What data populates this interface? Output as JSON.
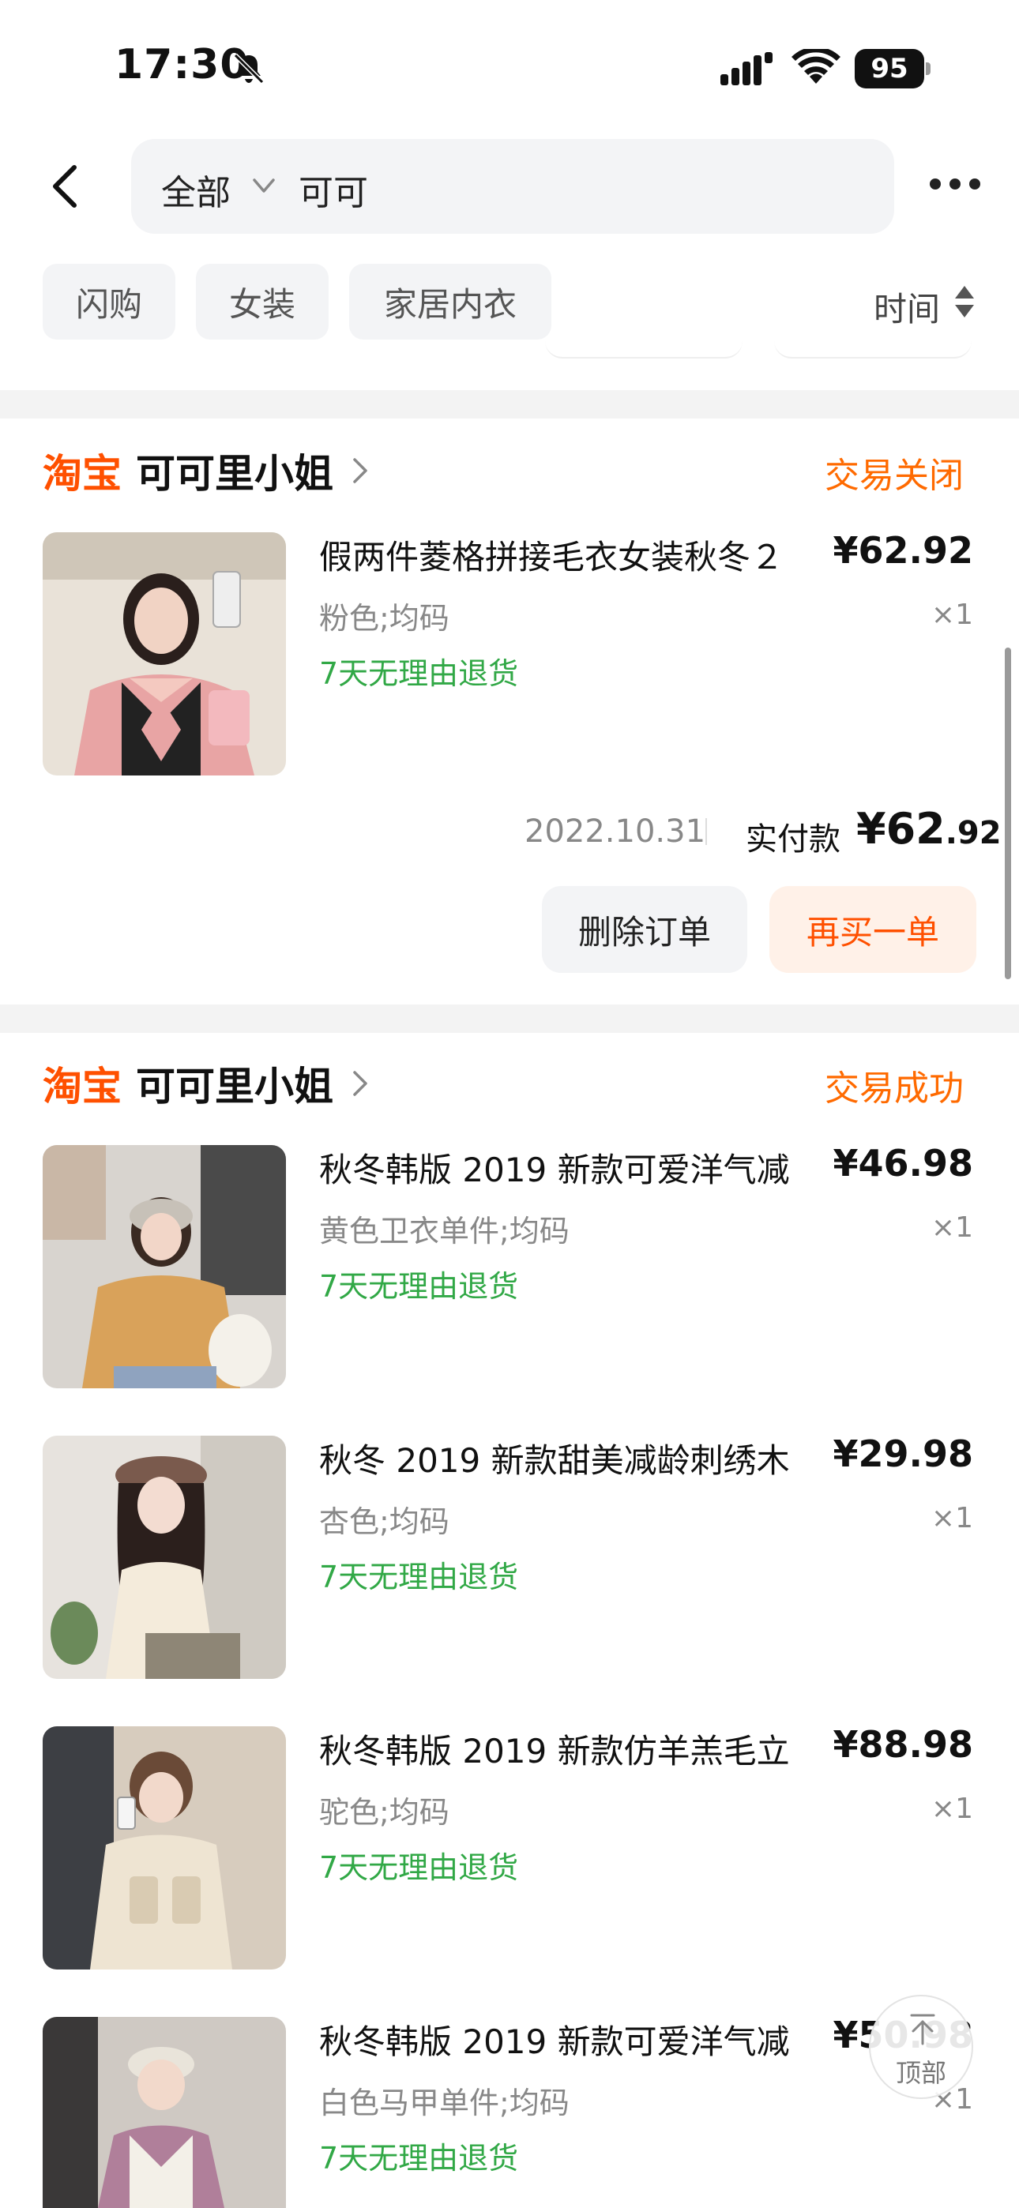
{
  "status_bar": {
    "time": "17:30",
    "battery": "95"
  },
  "header": {
    "scope": "全部",
    "query": "可可"
  },
  "filters": {
    "chips": [
      "闪购",
      "女装",
      "家居内衣"
    ],
    "sort_label": "时间"
  },
  "orders": [
    {
      "platform": "淘宝",
      "shop": "可可里小姐",
      "status": "交易关闭",
      "items": [
        {
          "title": "假两件菱格拼接毛衣女装秋冬２",
          "sku": "粉色;均码",
          "return": "7天无理由退货",
          "price": "¥62.92",
          "qty": "×1"
        }
      ],
      "date": "2022.10.31",
      "paid_label": "实付款",
      "paid_main": "¥62",
      "paid_decimal": ".92",
      "buttons": {
        "delete": "删除订单",
        "rebuy": "再买一单"
      }
    },
    {
      "platform": "淘宝",
      "shop": "可可里小姐",
      "status": "交易成功",
      "items": [
        {
          "title": "秋冬韩版 2019 新款可爱洋气减",
          "sku": "黄色卫衣单件;均码",
          "return": "7天无理由退货",
          "price": "¥46.98",
          "qty": "×1"
        },
        {
          "title": "秋冬 2019 新款甜美减龄刺绣木",
          "sku": "杏色;均码",
          "return": "7天无理由退货",
          "price": "¥29.98",
          "qty": "×1"
        },
        {
          "title": "秋冬韩版 2019 新款仿羊羔毛立",
          "sku": "驼色;均码",
          "return": "7天无理由退货",
          "price": "¥88.98",
          "qty": "×1"
        },
        {
          "title": "秋冬韩版 2019 新款可爱洋气减",
          "sku": "白色马甲单件;均码",
          "return": "7天无理由退货",
          "price": "¥50.98",
          "qty": "×1"
        }
      ]
    }
  ],
  "back_to_top": "顶部",
  "colors": {
    "accent": "#ff5000",
    "status": "#ff6a00",
    "return_green": "#31a846"
  }
}
